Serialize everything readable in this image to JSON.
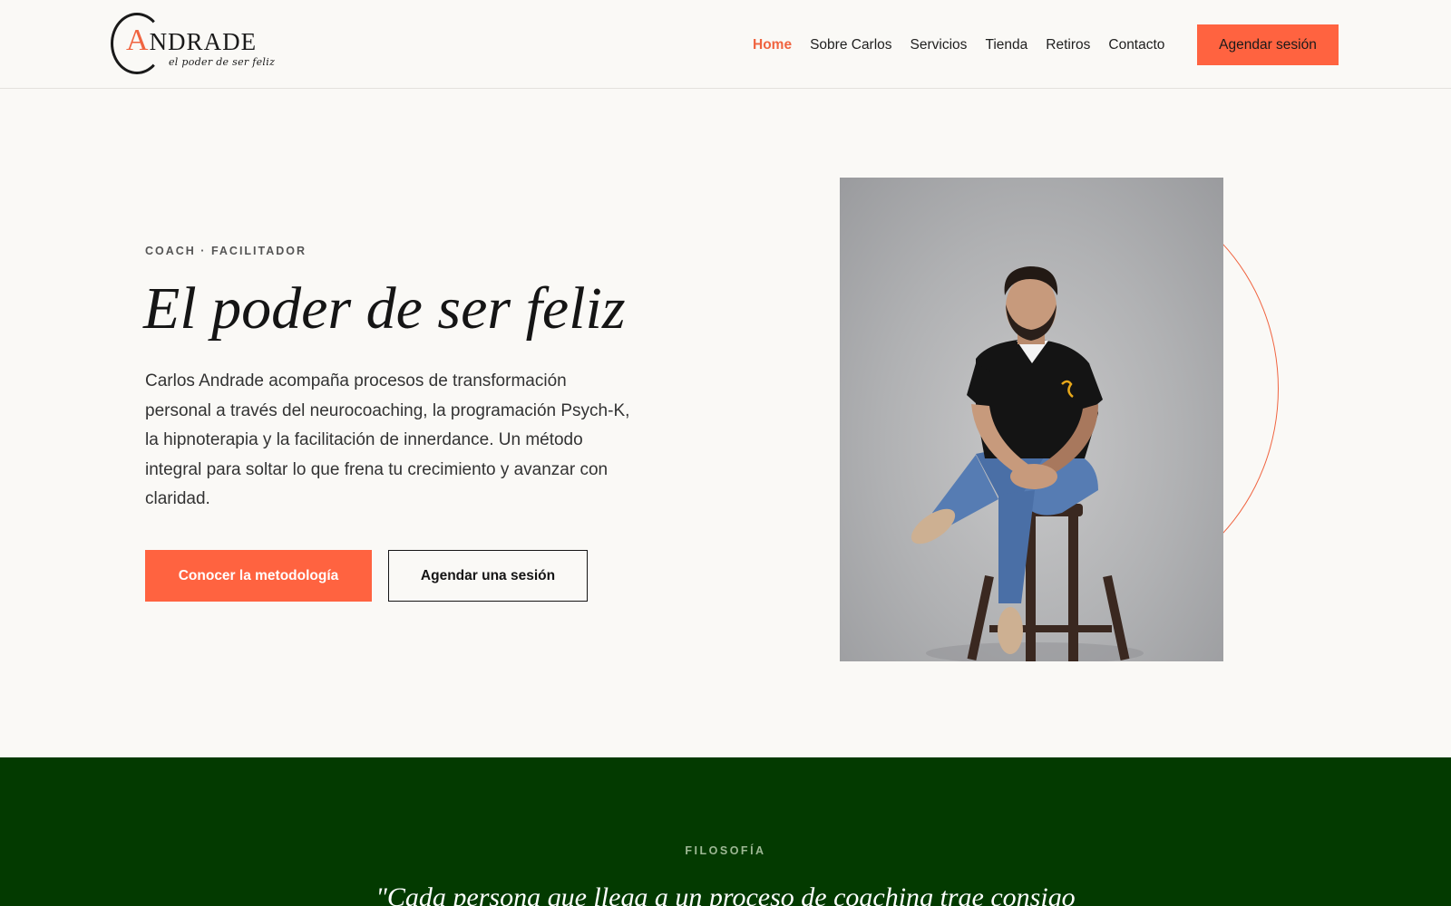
{
  "brand": {
    "logo_letter": "A",
    "logo_rest": "NDRADE",
    "tagline": "el poder de ser feliz"
  },
  "nav": {
    "items": [
      {
        "label": "Home",
        "active": true
      },
      {
        "label": "Sobre Carlos",
        "active": false
      },
      {
        "label": "Servicios",
        "active": false
      },
      {
        "label": "Tienda",
        "active": false
      },
      {
        "label": "Retiros",
        "active": false
      },
      {
        "label": "Contacto",
        "active": false
      }
    ],
    "cta_label": "Agendar sesión"
  },
  "hero": {
    "eyebrow": "COACH · FACILITADOR",
    "title": "El poder de ser feliz",
    "description": "Carlos Andrade acompaña procesos de transformación personal a través del neurocoaching, la programación Psych-K, la hipnoterapia y la facilitación de innerdance. Un método integral para soltar lo que frena tu crecimiento y avanzar con claridad.",
    "primary_button": "Conocer la metodología",
    "secondary_button": "Agendar una sesión"
  },
  "philosophy": {
    "eyebrow": "FILOSOFÍA",
    "quote": "\"Cada persona que llega a un proceso de coaching trae consigo"
  },
  "colors": {
    "accent": "#ff6340",
    "background": "#faf9f6",
    "band": "#033a00",
    "text": "#151515"
  }
}
